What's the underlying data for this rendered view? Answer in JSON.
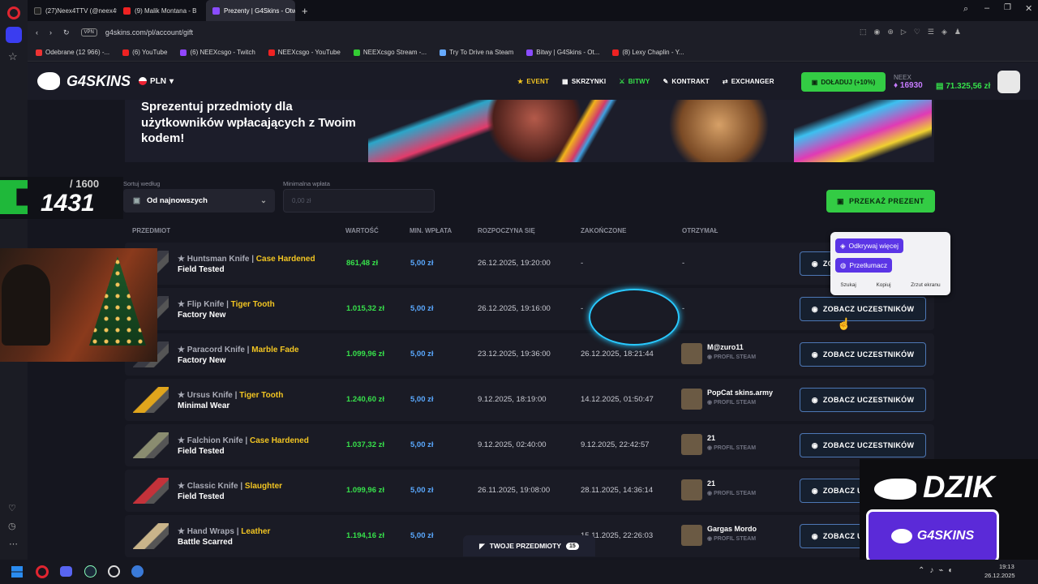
{
  "browser": {
    "tabs": [
      {
        "label": "(27)Neex4TTV (@neex4ttv)",
        "color": "#222"
      },
      {
        "label": "(9) Malik Montana - B",
        "color": "#e22"
      },
      {
        "label": "Prezenty | G4Skins - Otw",
        "color": "#8a4cff",
        "active": true
      }
    ],
    "url": "g4skins.com/pl/account/gift",
    "vpn": "VPN",
    "bookmarks": [
      {
        "label": "Odebrane (12 966) -...",
        "color": "#e33"
      },
      {
        "label": "(6) YouTube",
        "color": "#e22"
      },
      {
        "label": "(6) NEEXcsgo - Twitch",
        "color": "#9146ff"
      },
      {
        "label": "NEEXcsgo - YouTube",
        "color": "#e22"
      },
      {
        "label": "NEEXcsgo Stream -...",
        "color": "#3c3"
      },
      {
        "label": "Try To Drive na Steam",
        "color": "#6af"
      },
      {
        "label": "Bitwy | G4Skins - Ot...",
        "color": "#8a4cff"
      },
      {
        "label": "(8) Lexy Chaplin - Y...",
        "color": "#e22"
      }
    ]
  },
  "header": {
    "logo": "G4SKINS",
    "currency": "PLN",
    "nav": [
      {
        "label": "EVENT",
        "icon": "star-icon",
        "color": "#f2c522"
      },
      {
        "label": "SKRZYNKI",
        "icon": "crate-icon",
        "color": "#ffffff"
      },
      {
        "label": "BITWY",
        "icon": "battle-icon",
        "color": "#37e14b"
      },
      {
        "label": "KONTRAKT",
        "icon": "pen-icon",
        "color": "#ffffff"
      },
      {
        "label": "EXCHANGER",
        "icon": "exchange-icon",
        "color": "#ffffff"
      }
    ],
    "deposit_label": "DOŁADUJ (+10%)",
    "user_name": "NEEX",
    "points": "16930",
    "balance": "71.325,56 zł"
  },
  "banner": {
    "title": "Sprezentuj przedmioty dla użytkowników wpłacających z Twoim kodem!"
  },
  "stream": {
    "counter_total": "/ 1600",
    "counter_value": "1431",
    "dzik_label": "DZIK",
    "sponsor": "G4SKINS"
  },
  "filters": {
    "sort_label": "Sortuj według",
    "sort_value": "Od najnowszych",
    "min_label": "Minimalna wpłata",
    "min_placeholder": "0,00 zł",
    "gift_button": "PRZEKAŻ PREZENT"
  },
  "table": {
    "headers": [
      "PRZEDMIOT",
      "WARTOŚĆ",
      "MIN. WPŁATA",
      "ROZPOCZYNA SIĘ",
      "ZAKOŃCZONE",
      "OTRZYMAŁ"
    ],
    "see_label": "ZOBACZ UCZESTNIKÓW",
    "rows": [
      {
        "weapon": "Huntsman Knife",
        "skin": "Case Hardened",
        "wear": "Field Tested",
        "value": "861,48 zł",
        "min": "5,00 zł",
        "start": "26.12.2025, 19:20:00",
        "end": "-",
        "winner": "-",
        "profile": "",
        "knife_color": "#3a3b44"
      },
      {
        "weapon": "Flip Knife",
        "skin": "Tiger Tooth",
        "wear": "Factory New",
        "value": "1.015,32 zł",
        "min": "5,00 zł",
        "start": "26.12.2025, 19:16:00",
        "end": "-",
        "winner": "-",
        "profile": "",
        "knife_color": "#3a3b44"
      },
      {
        "weapon": "Paracord Knife",
        "skin": "Marble Fade",
        "wear": "Factory New",
        "value": "1.099,96 zł",
        "min": "5,00 zł",
        "start": "23.12.2025, 19:36:00",
        "end": "26.12.2025, 18:21:44",
        "winner": "M@zuro11",
        "profile": "PROFIL STEAM",
        "knife_color": "#3a3b44"
      },
      {
        "weapon": "Ursus Knife",
        "skin": "Tiger Tooth",
        "wear": "Minimal Wear",
        "value": "1.240,60 zł",
        "min": "5,00 zł",
        "start": "9.12.2025, 18:19:00",
        "end": "14.12.2025, 01:50:47",
        "winner": "PopCat skins.army",
        "profile": "PROFIL STEAM",
        "knife_color": "#e0a51c"
      },
      {
        "weapon": "Falchion Knife",
        "skin": "Case Hardened",
        "wear": "Field Tested",
        "value": "1.037,32 zł",
        "min": "5,00 zł",
        "start": "9.12.2025, 02:40:00",
        "end": "9.12.2025, 22:42:57",
        "winner": "21",
        "profile": "PROFIL STEAM",
        "knife_color": "#8a8c70"
      },
      {
        "weapon": "Classic Knife",
        "skin": "Slaughter",
        "wear": "Field Tested",
        "value": "1.099,96 zł",
        "min": "5,00 zł",
        "start": "26.11.2025, 19:08:00",
        "end": "28.11.2025, 14:36:14",
        "winner": "21",
        "profile": "PROFIL STEAM",
        "knife_color": "#c4323a"
      },
      {
        "weapon": "Hand Wraps",
        "skin": "Leather",
        "wear": "Battle Scarred",
        "value": "1.194,16 zł",
        "min": "5,00 zł",
        "start": "",
        "end": "15.11.2025, 22:26:03",
        "winner": "Gargas Mordo",
        "profile": "PROFIL STEAM",
        "knife_color": "#c9b48a"
      }
    ]
  },
  "popup": {
    "discover": "Odkrywaj więcej",
    "translate": "Przetłumacz",
    "footer": [
      "Szukaj",
      "Kopiuj",
      "Zrzut ekranu"
    ]
  },
  "bottom_bar": {
    "label": "TWOJE PRZEDMIOTY",
    "count": "15"
  },
  "taskbar": {
    "time": "19:13",
    "date": "26.12.2025"
  }
}
